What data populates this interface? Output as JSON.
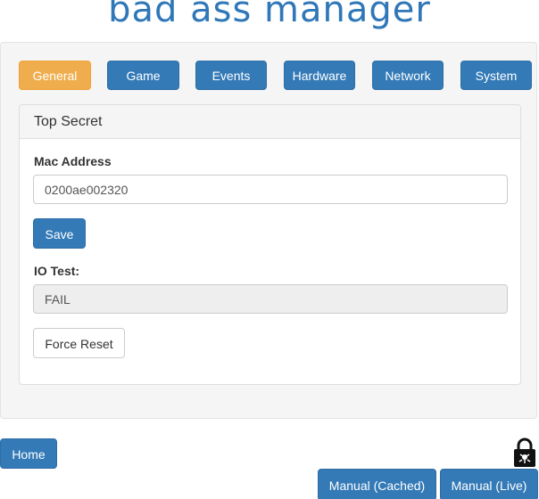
{
  "app": {
    "title": "bad ass manager"
  },
  "tabs": [
    {
      "label": "General",
      "active": true
    },
    {
      "label": "Game",
      "active": false
    },
    {
      "label": "Events",
      "active": false
    },
    {
      "label": "Hardware",
      "active": false
    },
    {
      "label": "Network",
      "active": false
    },
    {
      "label": "System",
      "active": false
    }
  ],
  "panel": {
    "heading": "Top Secret",
    "mac": {
      "label": "Mac Address",
      "value": "0200ae002320"
    },
    "save_label": "Save",
    "io_test": {
      "label": "IO Test:",
      "value": "FAIL"
    },
    "force_reset_label": "Force Reset"
  },
  "footer": {
    "home_label": "Home",
    "manual_cached_label": "Manual (Cached)",
    "manual_live_label": "Manual (Live)",
    "lock_icon": "lock-icon"
  },
  "colors": {
    "primary": "#337ab7",
    "warning": "#f0ad4e",
    "title": "#2f77b8"
  }
}
